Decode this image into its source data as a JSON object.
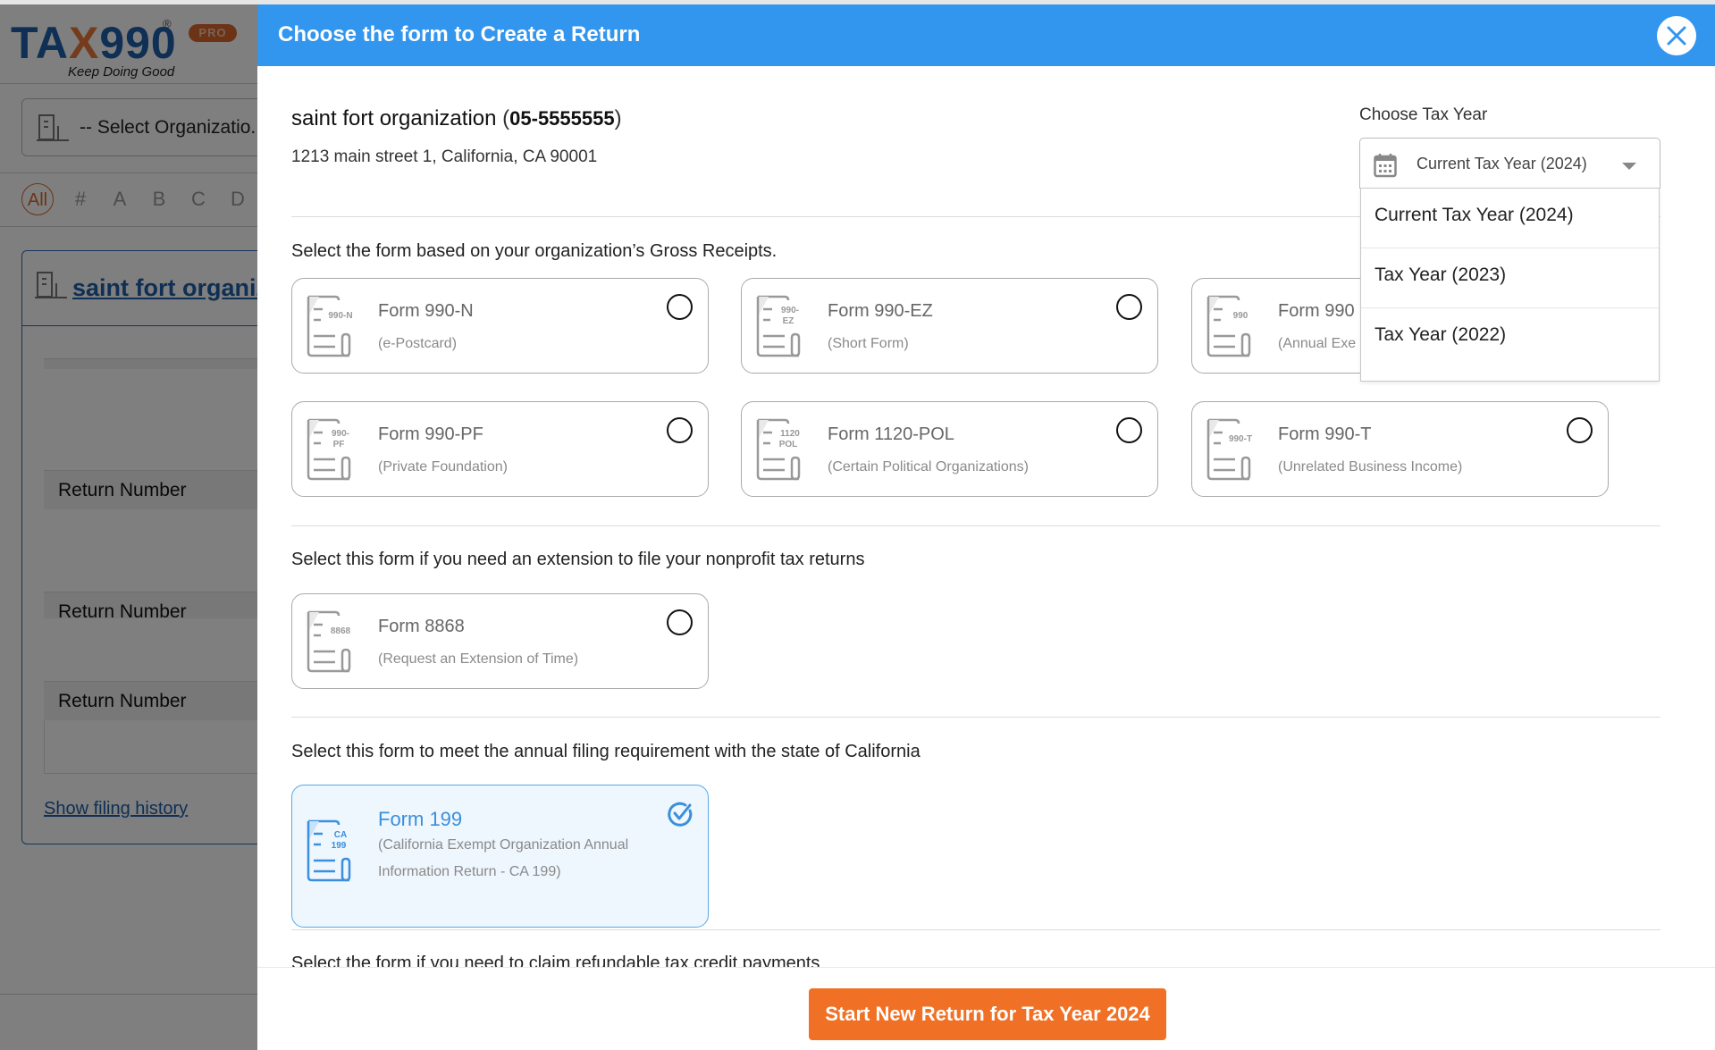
{
  "app": {
    "logo": {
      "brand_prefix": "TA",
      "brand_x": "X",
      "brand_suffix": "990",
      "registered": "®",
      "badge": "PRO",
      "tagline": "Keep Doing Good"
    },
    "org_select_placeholder": "-- Select Organizatio...",
    "alpha_filter": [
      "All",
      "#",
      "A",
      "B",
      "C",
      "D"
    ],
    "org_card": {
      "name": "saint fort organiz",
      "return_number_label": "Return Number",
      "show_history_link": "Show filing history"
    }
  },
  "modal": {
    "title": "Choose the form to Create a Return",
    "close_icon": "close-icon",
    "organization": {
      "name": "saint fort organization",
      "ein": "05-5555555",
      "address": "1213 main street 1, California, CA 90001"
    },
    "tax_year": {
      "label": "Choose Tax Year",
      "selected": "Current Tax Year (2024)",
      "options": [
        "Current Tax Year (2024)",
        "Tax Year (2023)",
        "Tax Year (2022)"
      ],
      "expanded": true
    },
    "sections": [
      {
        "label": "Select the form based on your organization’s Gross Receipts.",
        "forms": [
          {
            "icon_text": "990-N",
            "name": "Form 990-N",
            "desc": "(e-Postcard)",
            "selected": false
          },
          {
            "icon_text": "990-EZ",
            "name": "Form 990-EZ",
            "desc": "(Short Form)",
            "selected": false
          },
          {
            "icon_text": "990",
            "name": "Form 990",
            "desc": "(Annual Exe",
            "selected": false
          },
          {
            "icon_text": "990-PF",
            "name": "Form 990-PF",
            "desc": "(Private Foundation)",
            "selected": false
          },
          {
            "icon_text": "1120 POL",
            "name": "Form 1120-POL",
            "desc": "(Certain Political Organizations)",
            "selected": false
          },
          {
            "icon_text": "990-T",
            "name": "Form 990-T",
            "desc": "(Unrelated Business Income)",
            "selected": false
          }
        ]
      },
      {
        "label": "Select this form if you need an extension to file your nonprofit tax returns",
        "forms": [
          {
            "icon_text": "8868",
            "name": "Form 8868",
            "desc": "(Request an Extension of Time)",
            "selected": false
          }
        ]
      },
      {
        "label": "Select this form to meet the annual filing requirement with the state of California",
        "forms": [
          {
            "icon_text": "CA 199",
            "name": "Form 199",
            "desc": "(California Exempt Organization Annual Information Return - CA 199)",
            "selected": true
          }
        ]
      },
      {
        "label": "Select the form if you need to claim refundable tax credit payments",
        "forms": []
      }
    ],
    "footer": {
      "start_button": "Start New Return for Tax Year 2024"
    }
  },
  "colors": {
    "header_blue": "#3396ee",
    "brand_blue": "#1f5fa8",
    "accent_orange": "#f07125",
    "selected_card_bg": "#eef6fe",
    "selected_card_border": "#5aa9e6"
  }
}
